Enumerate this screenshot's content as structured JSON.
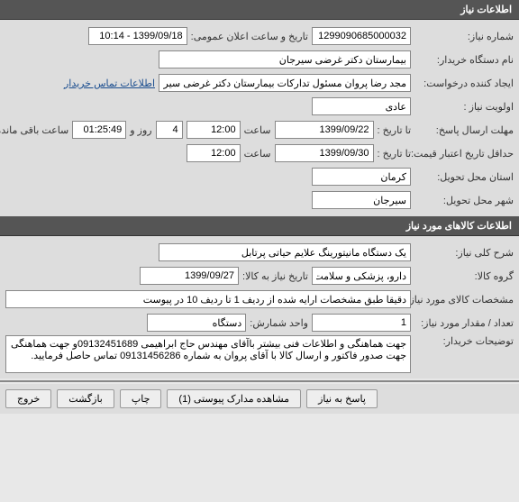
{
  "headers": {
    "need_info": "اطلاعات نیاز",
    "goods_info": "اطلاعات کالاهای مورد نیاز"
  },
  "labels": {
    "need_number": "شماره نیاز:",
    "public_date": "تاریخ و ساعت اعلان عمومی:",
    "buyer_name": "نام دستگاه خریدار:",
    "request_creator": "ایجاد کننده درخواست:",
    "priority": "اولویت نیاز :",
    "contact_info": "اطلاعات تماس خریدار",
    "response_deadline": "مهلت ارسال پاسخ:",
    "until_date": "تا تاریخ :",
    "hour": "ساعت",
    "day_and": "روز و",
    "remaining": "ساعت باقی مانده",
    "min_credit_date": "حداقل تاریخ اعتبار قیمت:",
    "delivery_province": "استان محل تحویل:",
    "delivery_city": "شهر محل تحویل:",
    "general_desc": "شرح کلی نیاز:",
    "goods_group": "گروه کالا:",
    "need_date": "تاریخ نیاز به کالا:",
    "goods_specs": "مشخصات کالای مورد نیاز:",
    "qty_needed": "تعداد / مقدار مورد نیاز:",
    "count_unit": "واحد شمارش:",
    "buyer_notes": "توضیحات خریدار:"
  },
  "values": {
    "need_number": "1299090685000032",
    "public_date": "1399/09/18 - 10:14",
    "buyer_name": "بیمارستان دکتر غرضی سیرجان",
    "request_creator": "مجد رضا پروان مسئول تدارکات بیمارستان دکتر غرضی سیرجان",
    "priority": "عادی",
    "deadline_date": "1399/09/22",
    "deadline_time": "12:00",
    "remaining_days": "4",
    "remaining_time": "01:25:49",
    "credit_until_date": "1399/09/30",
    "credit_until_time": "12:00",
    "delivery_province": "کرمان",
    "delivery_city": "سیرجان",
    "general_desc": "یک دستگاه مانیتورینگ علایم حیاتی پرتابل",
    "goods_group": "دارو، پزشکی و سلامت",
    "need_date": "1399/09/27",
    "goods_specs": "دقیقا طبق مشخصات ارایه شده از ردیف 1 تا ردیف 10 در پیوست",
    "qty_needed": "1",
    "count_unit": "دستگاه",
    "buyer_notes": "جهت هماهنگی و اطلاعات فنی بیشتر باآقای مهندس حاج ابراهیمی 09132451689و جهت هماهنگی جهت صدور فاکتور و ارسال کالا با آقای پروان به شماره 09131456286 تماس حاصل فرمایید."
  },
  "buttons": {
    "respond": "پاسخ به نیاز",
    "attachments": "مشاهده مدارک پیوستی (1)",
    "print": "چاپ",
    "back": "بازگشت",
    "exit": "خروج"
  }
}
